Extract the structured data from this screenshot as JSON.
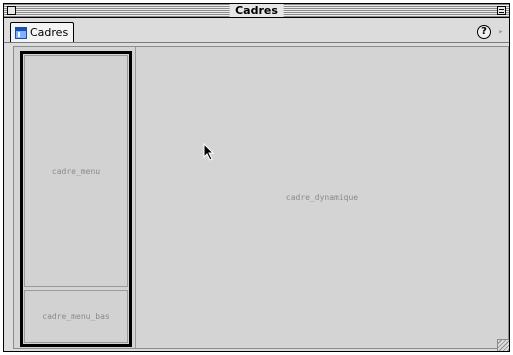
{
  "window": {
    "title": "Cadres"
  },
  "tabs": [
    {
      "label": "Cadres",
      "icon": "frame-icon"
    }
  ],
  "toolbar": {
    "help_label": "?",
    "arrow_label": "▸"
  },
  "frames": {
    "menu": "cadre_menu",
    "menu_bas": "cadre_menu_bas",
    "dynamique": "cadre_dynamique"
  },
  "icons": {
    "close": "close-box-icon",
    "zoom": "zoom-box-icon",
    "cursor": "arrow-cursor-icon",
    "grow": "resize-grip-icon"
  }
}
